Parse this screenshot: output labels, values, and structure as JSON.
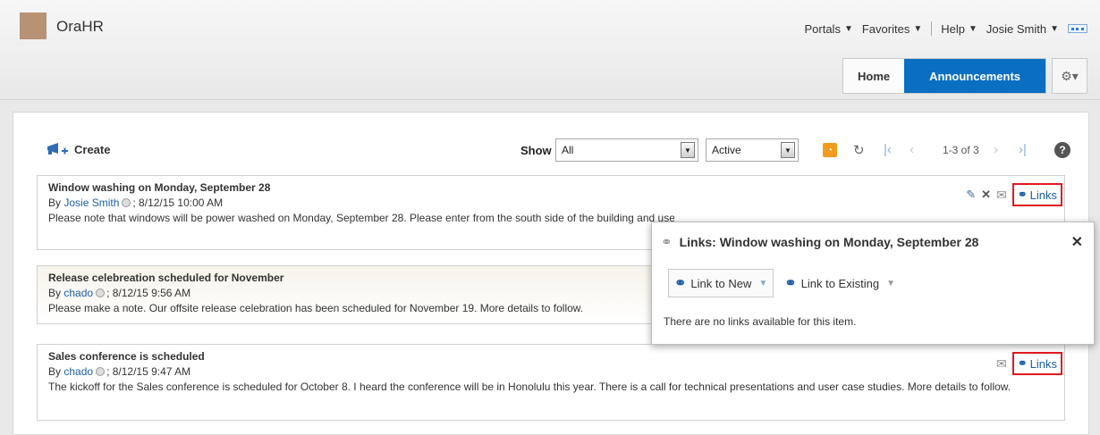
{
  "app": {
    "name": "OraHR"
  },
  "global_nav": {
    "portals": "Portals",
    "favorites": "Favorites",
    "help": "Help",
    "user": "Josie Smith"
  },
  "tabs": {
    "home": "Home",
    "announcements": "Announcements"
  },
  "toolbar": {
    "create": "Create",
    "show_label": "Show",
    "show_value": "All",
    "status_value": "Active",
    "pager": "1-3 of 3"
  },
  "announcements": [
    {
      "title": "Window washing on Monday, September 28",
      "by": "By",
      "author": "Josie Smith",
      "date": "; 8/12/15 10:00 AM",
      "body": "Please note that windows will be power washed on Monday, September 28. Please enter from the south side of the building and use below ground entrances to access the office building.",
      "links_label": "Links"
    },
    {
      "title": "Release celebreation scheduled for November",
      "by": "By",
      "author": "chado",
      "date": "; 8/12/15 9:56 AM",
      "body": "Please make a note. Our offsite release celebration has been scheduled for November 19. More details to follow."
    },
    {
      "title": "Sales conference is scheduled",
      "by": "By",
      "author": "chado",
      "date": "; 8/12/15 9:47 AM",
      "body": "The kickoff for the Sales conference is scheduled for October 8. I heard the conference will be in Honolulu this year. There is a call for technical presentations and user case studies. More details to follow.",
      "links_label": "Links"
    }
  ],
  "popup": {
    "title": "Links: Window washing on Monday, September 28",
    "link_to_new": "Link to New",
    "link_to_existing": "Link to Existing",
    "empty_message": "There are no links available for this item."
  }
}
